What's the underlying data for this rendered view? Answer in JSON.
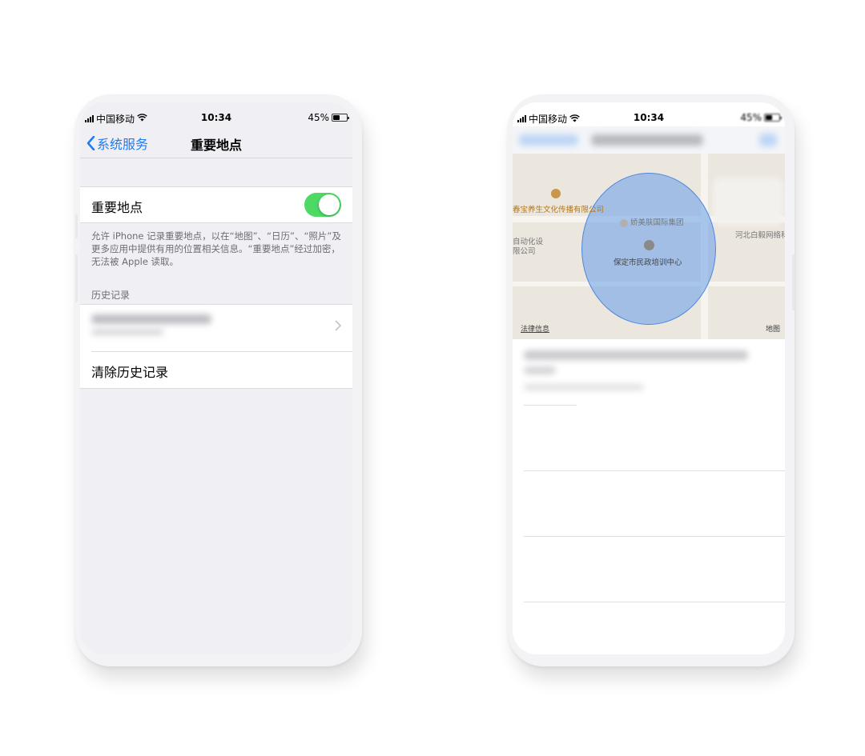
{
  "status_bar": {
    "carrier": "中国移动",
    "time": "10:34",
    "battery": "45%",
    "battery_level": 0.45
  },
  "left_screen": {
    "nav": {
      "back_label": "系统服务",
      "title": "重要地点"
    },
    "toggle_row": {
      "label": "重要地点",
      "enabled": true
    },
    "footnote": "允许 iPhone 记录重要地点，以在“地图”、“日历”、“照片”及更多应用中提供有用的位置相关信息。“重要地点”经过加密，无法被 Apple 读取。",
    "history_header": "历史记录",
    "clear_history_label": "清除历史记录"
  },
  "right_screen": {
    "map_labels": {
      "poi_1": "春宝养生文化传播有限公司",
      "poi_2": "娇美肤国际集团",
      "poi_3": "保定市民政培训中心",
      "poi_4": "河北白毅网络科",
      "poi_5": "自动化设",
      "poi_6": "限公司",
      "legal": "法律信息",
      "maps_brand": "地图"
    }
  },
  "colors": {
    "accent_blue": "#1e7bf5",
    "toggle_green": "#4cd964",
    "region_circle": "#72a4e8"
  }
}
